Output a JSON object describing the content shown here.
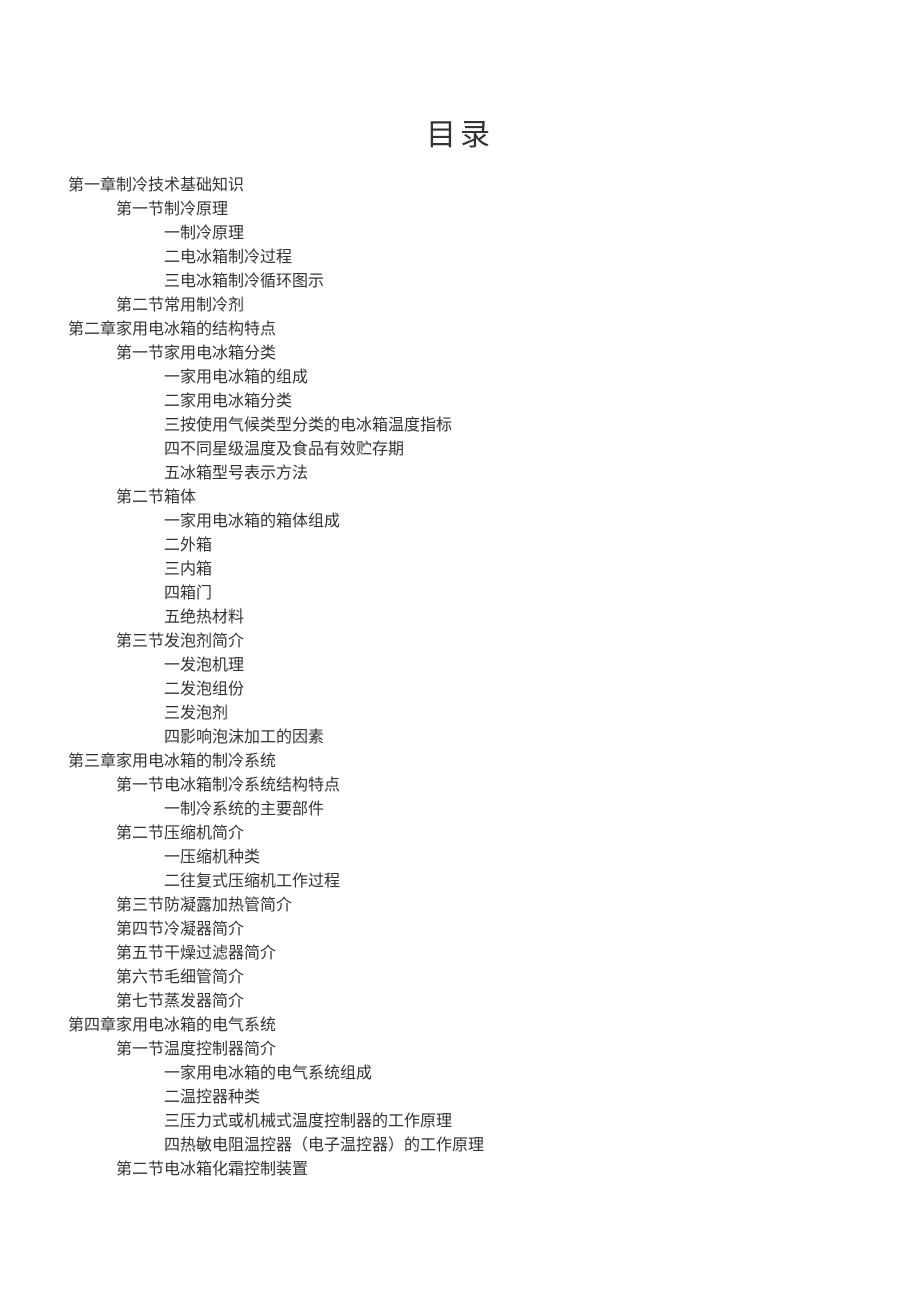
{
  "title": "目录",
  "toc": {
    "chapters": [
      {
        "label": "第一章制冷技术基础知识",
        "sections": [
          {
            "label": "第一节制冷原理",
            "items": [
              "一制冷原理",
              "二电冰箱制冷过程",
              "三电冰箱制冷循环图示"
            ]
          },
          {
            "label": "第二节常用制冷剂",
            "items": []
          }
        ]
      },
      {
        "label": "第二章家用电冰箱的结构特点",
        "sections": [
          {
            "label": "第一节家用电冰箱分类",
            "items": [
              "一家用电冰箱的组成",
              "二家用电冰箱分类",
              "三按使用气候类型分类的电冰箱温度指标",
              "四不同星级温度及食品有效贮存期",
              "五冰箱型号表示方法"
            ]
          },
          {
            "label": "第二节箱体",
            "items": [
              "一家用电冰箱的箱体组成",
              "二外箱",
              "三内箱",
              "四箱门",
              "五绝热材料"
            ]
          },
          {
            "label": "第三节发泡剂简介",
            "items": [
              "一发泡机理",
              "二发泡组份",
              "三发泡剂",
              "四影响泡沫加工的因素"
            ]
          }
        ]
      },
      {
        "label": "第三章家用电冰箱的制冷系统",
        "sections": [
          {
            "label": "第一节电冰箱制冷系统结构特点",
            "items": [
              "一制冷系统的主要部件"
            ]
          },
          {
            "label": "第二节压缩机简介",
            "items": [
              "一压缩机种类",
              "二往复式压缩机工作过程"
            ]
          },
          {
            "label": "第三节防凝露加热管简介",
            "items": []
          },
          {
            "label": "第四节冷凝器简介",
            "items": []
          },
          {
            "label": "第五节干燥过滤器简介",
            "items": []
          },
          {
            "label": "第六节毛细管简介",
            "items": []
          },
          {
            "label": "第七节蒸发器简介",
            "items": []
          }
        ]
      },
      {
        "label": "第四章家用电冰箱的电气系统",
        "sections": [
          {
            "label": "第一节温度控制器简介",
            "items": [
              "一家用电冰箱的电气系统组成",
              "二温控器种类",
              "三压力式或机械式温度控制器的工作原理",
              "四热敏电阻温控器（电子温控器）的工作原理"
            ]
          },
          {
            "label": "第二节电冰箱化霜控制装置",
            "items": []
          }
        ]
      }
    ]
  }
}
